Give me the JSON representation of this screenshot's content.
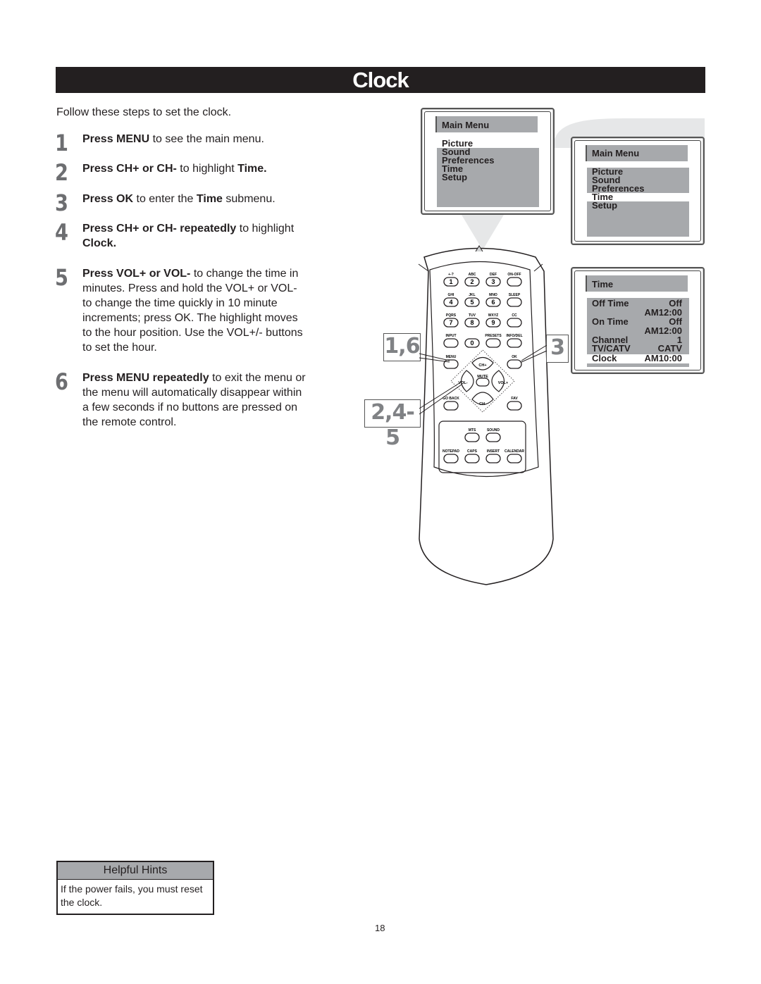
{
  "page": {
    "title": "Clock",
    "intro": "Follow these steps to set the clock.",
    "page_number": "18"
  },
  "steps": [
    {
      "num": "1",
      "parts": [
        {
          "b": true,
          "t": "Press MENU"
        },
        {
          "b": false,
          "t": " to see the main menu."
        }
      ]
    },
    {
      "num": "2",
      "parts": [
        {
          "b": true,
          "t": "Press CH+ or CH-"
        },
        {
          "b": false,
          "t": " to highlight "
        },
        {
          "b": true,
          "t": "Time."
        }
      ]
    },
    {
      "num": "3",
      "parts": [
        {
          "b": true,
          "t": "Press OK"
        },
        {
          "b": false,
          "t": " to enter the "
        },
        {
          "b": true,
          "t": "Time"
        },
        {
          "b": false,
          "t": " submenu."
        }
      ]
    },
    {
      "num": "4",
      "parts": [
        {
          "b": true,
          "t": "Press CH+ or CH- repeatedly"
        },
        {
          "b": false,
          "t": " to highlight "
        },
        {
          "b": true,
          "t": "Clock."
        }
      ]
    },
    {
      "num": "5",
      "parts": [
        {
          "b": true,
          "t": "Press VOL+ or VOL-"
        },
        {
          "b": false,
          "t": " to change the time in minutes. Press and hold the VOL+ or VOL- to change the time quickly in 10 minute increments; press OK. The highlight moves to the hour position. Use the VOL+/- buttons to set the hour."
        }
      ]
    },
    {
      "num": "6",
      "parts": [
        {
          "b": true,
          "t": "Press MENU repeatedly"
        },
        {
          "b": false,
          "t": " to exit the menu or the menu will automatically disappear within a few seconds if no buttons are pressed on the remote control."
        }
      ]
    }
  ],
  "screens": {
    "main_menu_1": {
      "header": "Main Menu",
      "items": [
        "Picture",
        "Sound",
        "Preferences",
        "Time",
        "Setup"
      ],
      "highlighted": "Picture"
    },
    "main_menu_2": {
      "header": "Main Menu",
      "items": [
        "Picture",
        "Sound",
        "Preferences",
        "Time",
        "Setup"
      ],
      "highlighted": "Time"
    },
    "time_menu": {
      "header": "Time",
      "rows": [
        {
          "label": "Off Time",
          "value": "Off"
        },
        {
          "label": "",
          "value": "AM12:00"
        },
        {
          "label": "On Time",
          "value": "Off"
        },
        {
          "label": "",
          "value": "AM12:00"
        },
        {
          "label": "Channel",
          "value": "1"
        },
        {
          "label": "TV/CATV",
          "value": "CATV"
        },
        {
          "label": "Clock",
          "value": "AM10:00"
        }
      ],
      "highlighted": "Clock"
    }
  },
  "callouts": {
    "menu_steps": "1,6",
    "ok_step": "3",
    "nav_steps": "2,4-5"
  },
  "remote": {
    "keypad": [
      {
        "top": "+-?",
        "label": "1"
      },
      {
        "top": "ABC",
        "label": "2"
      },
      {
        "top": "DEF",
        "label": "3"
      },
      {
        "top": "ON-OFF",
        "label": ""
      },
      {
        "top": "GHI",
        "label": "4"
      },
      {
        "top": "JKL",
        "label": "5"
      },
      {
        "top": "MNO",
        "label": "6"
      },
      {
        "top": "SLEEP",
        "label": ""
      },
      {
        "top": "PQRS",
        "label": "7"
      },
      {
        "top": "TUV",
        "label": "8"
      },
      {
        "top": "WXYZ",
        "label": "9"
      },
      {
        "top": "CC",
        "label": ""
      },
      {
        "top": "INPUT",
        "label": ""
      },
      {
        "top": "",
        "label": "0"
      },
      {
        "top": "PRESETS",
        "label": ""
      },
      {
        "top": "INFO/DEL",
        "label": ""
      }
    ],
    "menu": "MENU",
    "ok": "OK",
    "ch_up": "CH+",
    "ch_down": "CH-",
    "vol_down": "VOL-",
    "vol_up": "VOL+",
    "mute": "MUTE",
    "go_back": "GO BACK",
    "fav": "FAV",
    "mts": "MTS",
    "sound": "SOUND",
    "notepad": "NOTEPAD",
    "caps": "CAPS",
    "insert": "INSERT",
    "calendar": "CALENDAR"
  },
  "hints": {
    "header": "Helpful Hints",
    "body": "If the power fails, you must reset the clock."
  }
}
